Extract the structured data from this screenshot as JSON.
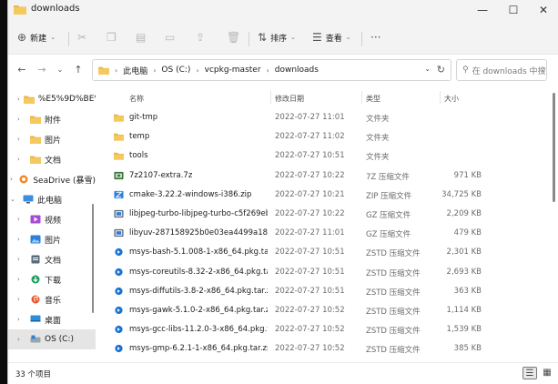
{
  "window": {
    "title": "downloads",
    "controls": {
      "minimize": "—",
      "maximize": "☐",
      "close": "✕"
    }
  },
  "toolbar": {
    "new_label": "新建",
    "sort_label": "排序",
    "view_label": "查看",
    "more_label": "···"
  },
  "address": {
    "crumbs": [
      "此电脑",
      "OS (C:)",
      "vcpkg-master",
      "downloads"
    ],
    "search_placeholder": "在 downloads 中搜索"
  },
  "nav": {
    "items": [
      {
        "label": "%E5%9D%BE%E5",
        "icon": "folder-icon",
        "indent": 1,
        "expander": "›"
      },
      {
        "label": "附件",
        "icon": "folder-icon",
        "indent": 1,
        "expander": "›"
      },
      {
        "label": "图片",
        "icon": "folder-icon",
        "indent": 1,
        "expander": "›"
      },
      {
        "label": "文档",
        "icon": "folder-icon",
        "indent": 1,
        "expander": "›"
      },
      {
        "label": "SeaDrive (暴雪)",
        "icon": "seadrive-icon",
        "indent": 0,
        "expander": "›"
      },
      {
        "label": "此电脑",
        "icon": "computer-icon",
        "indent": 0,
        "expander": "⌄"
      },
      {
        "label": "视频",
        "icon": "video-icon",
        "indent": 1,
        "expander": "›"
      },
      {
        "label": "图片",
        "icon": "pictures-icon",
        "indent": 1,
        "expander": "›"
      },
      {
        "label": "文档",
        "icon": "documents-icon",
        "indent": 1,
        "expander": "›"
      },
      {
        "label": "下载",
        "icon": "download-icon",
        "indent": 1,
        "expander": "›"
      },
      {
        "label": "音乐",
        "icon": "music-icon",
        "indent": 1,
        "expander": "›"
      },
      {
        "label": "桌面",
        "icon": "desktop-icon",
        "indent": 1,
        "expander": "›"
      },
      {
        "label": "OS (C:)",
        "icon": "drive-icon",
        "indent": 1,
        "expander": "›",
        "selected": true
      }
    ]
  },
  "files": {
    "columns": {
      "name": "名称",
      "date": "修改日期",
      "type": "类型",
      "size": "大小"
    },
    "rows": [
      {
        "name": "git-tmp",
        "date": "2022-07-27 11:01",
        "type": "文件夹",
        "size": "",
        "icon": "folder-icon"
      },
      {
        "name": "temp",
        "date": "2022-07-27 11:02",
        "type": "文件夹",
        "size": "",
        "icon": "folder-icon"
      },
      {
        "name": "tools",
        "date": "2022-07-27 10:51",
        "type": "文件夹",
        "size": "",
        "icon": "folder-icon"
      },
      {
        "name": "7z2107-extra.7z",
        "date": "2022-07-27 10:22",
        "type": "7Z 压缩文件",
        "size": "971 KB",
        "icon": "archive-7z-icon"
      },
      {
        "name": "cmake-3.22.2-windows-i386.zip",
        "date": "2022-07-27 10:21",
        "type": "ZIP 压缩文件",
        "size": "34,725 KB",
        "icon": "archive-zip-icon"
      },
      {
        "name": "libjpeg-turbo-libjpeg-turbo-c5f269eb...",
        "date": "2022-07-27 10:22",
        "type": "GZ 压缩文件",
        "size": "2,209 KB",
        "icon": "archive-gz-icon"
      },
      {
        "name": "libyuv-287158925b0e03ea4499a18b4...",
        "date": "2022-07-27 11:01",
        "type": "GZ 压缩文件",
        "size": "479 KB",
        "icon": "archive-gz-icon"
      },
      {
        "name": "msys-bash-5.1.008-1-x86_64.pkg.tar....",
        "date": "2022-07-27 10:51",
        "type": "ZSTD 压缩文件",
        "size": "2,301 KB",
        "icon": "zst-icon"
      },
      {
        "name": "msys-coreutils-8.32-2-x86_64.pkg.tar....",
        "date": "2022-07-27 10:51",
        "type": "ZSTD 压缩文件",
        "size": "2,693 KB",
        "icon": "zst-icon"
      },
      {
        "name": "msys-diffutils-3.8-2-x86_64.pkg.tar.zst",
        "date": "2022-07-27 10:51",
        "type": "ZSTD 压缩文件",
        "size": "363 KB",
        "icon": "zst-icon"
      },
      {
        "name": "msys-gawk-5.1.0-2-x86_64.pkg.tar.zst",
        "date": "2022-07-27 10:52",
        "type": "ZSTD 压缩文件",
        "size": "1,114 KB",
        "icon": "zst-icon"
      },
      {
        "name": "msys-gcc-libs-11.2.0-3-x86_64.pkg.ta...",
        "date": "2022-07-27 10:52",
        "type": "ZSTD 压缩文件",
        "size": "1,539 KB",
        "icon": "zst-icon"
      },
      {
        "name": "msys-gmp-6.2.1-1-x86_64.pkg.tar.zst",
        "date": "2022-07-27 10:52",
        "type": "ZSTD 压缩文件",
        "size": "385 KB",
        "icon": "zst-icon"
      }
    ]
  },
  "status": {
    "count_text": "33 个项目"
  },
  "colors": {
    "folder": "#e8b64a",
    "zst": "#1a73d1",
    "selection": "#e5e5e5"
  }
}
